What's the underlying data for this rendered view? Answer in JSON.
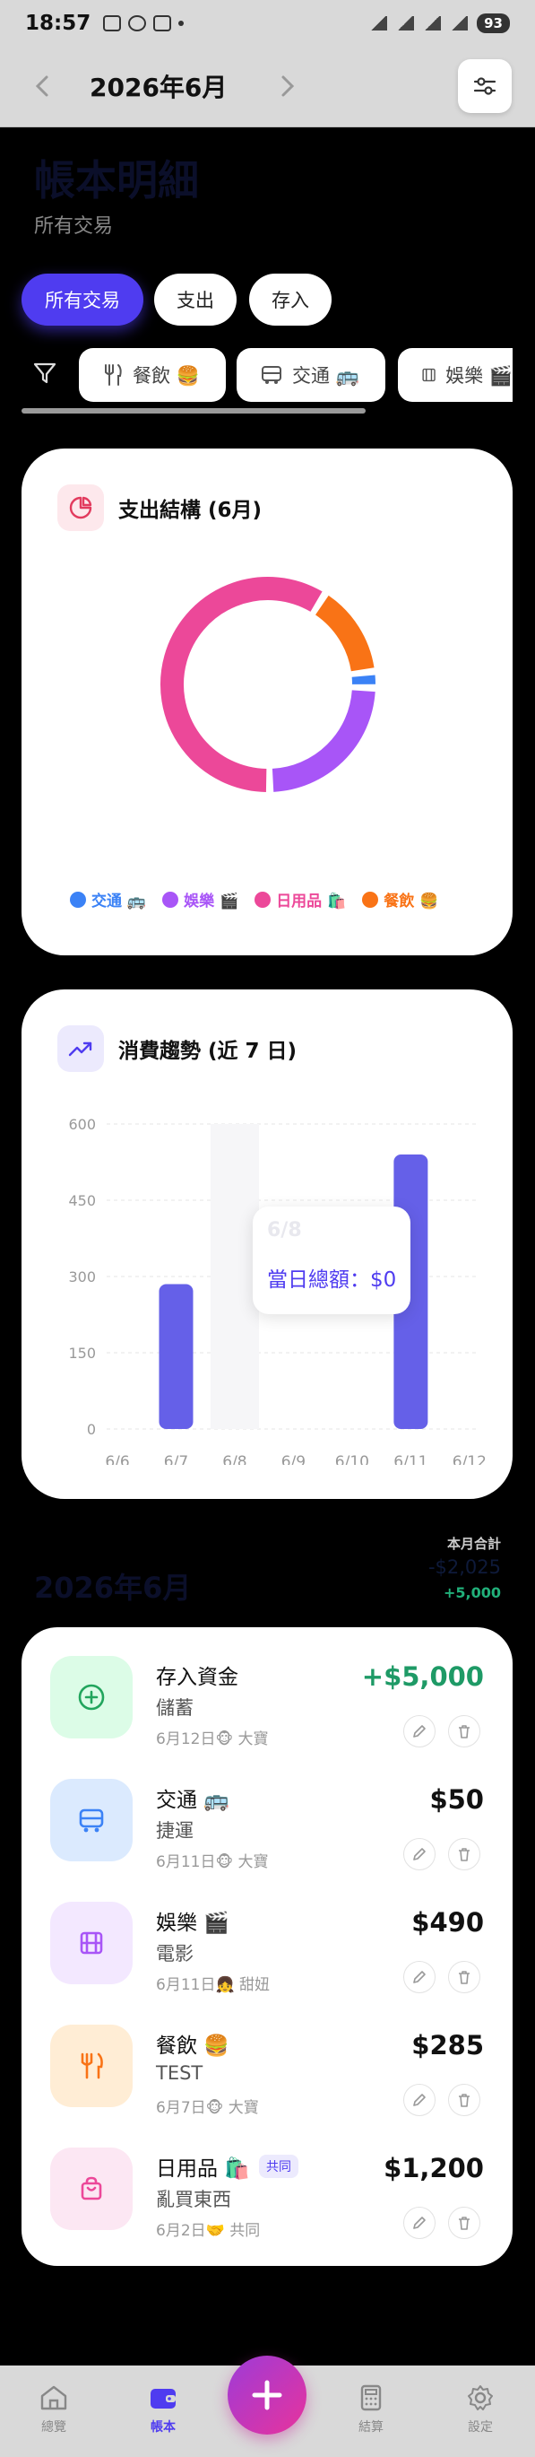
{
  "status_bar": {
    "time": "18:57",
    "battery": "93"
  },
  "header": {
    "month_title": "2026年6月"
  },
  "page": {
    "title": "帳本明細",
    "subtitle": "所有交易"
  },
  "segments": [
    {
      "label": "所有交易",
      "active": true
    },
    {
      "label": "支出",
      "active": false
    },
    {
      "label": "存入",
      "active": false
    }
  ],
  "categories": [
    {
      "label": "餐飲 🍔",
      "icon": "utensils-icon"
    },
    {
      "label": "交通 🚌",
      "icon": "bus-icon"
    },
    {
      "label": "娛樂 🎬",
      "icon": "film-icon"
    }
  ],
  "structure_card": {
    "title": "支出結構 (6月)",
    "legend": [
      {
        "label": "交通 🚌",
        "color": "#3b82f6"
      },
      {
        "label": "娛樂 🎬",
        "color": "#a855f7"
      },
      {
        "label": "日用品 🛍️",
        "color": "#ec4899"
      },
      {
        "label": "餐飲 🍔",
        "color": "#f97316"
      }
    ]
  },
  "trend_card": {
    "title": "消費趨勢 (近 7 日)",
    "tooltip": {
      "date": "6/8",
      "text": "當日總額：$0"
    }
  },
  "chart_data": [
    {
      "type": "pie",
      "title": "支出結構 (6月)",
      "categories": [
        "交通 🚌",
        "娛樂 🎬",
        "日用品 🛍️",
        "餐飲 🍔"
      ],
      "values": [
        50,
        490,
        1200,
        285
      ],
      "colors": [
        "#3b82f6",
        "#a855f7",
        "#ec4899",
        "#f97316"
      ]
    },
    {
      "type": "bar",
      "title": "消費趨勢 (近 7 日)",
      "categories": [
        "6/6",
        "6/7",
        "6/8",
        "6/9",
        "6/10",
        "6/11",
        "6/12"
      ],
      "values": [
        0,
        285,
        0,
        0,
        0,
        540,
        0
      ],
      "yticks": [
        0,
        150,
        300,
        450,
        600
      ],
      "ylim": [
        0,
        600
      ],
      "grid": true,
      "bar_color": "#6560e8",
      "highlight_category": "6/8"
    }
  ],
  "month_summary": {
    "title": "2026年6月",
    "label": "本月合計",
    "net": "-$2,025",
    "income": "+5,000"
  },
  "transactions": [
    {
      "icon": "plus-circle-icon",
      "icon_bg": "#dcfce7",
      "icon_color": "#22a55d",
      "title": "存入資金",
      "subtitle": "儲蓄",
      "meta": "6月12日🐵 大寶",
      "amount": "+$5,000",
      "income": true,
      "badge": ""
    },
    {
      "icon": "bus-icon",
      "icon_bg": "#dbeafe",
      "icon_color": "#3b82f6",
      "title": "交通 🚌",
      "subtitle": "捷運",
      "meta": "6月11日🐵 大寶",
      "amount": "$50",
      "income": false,
      "badge": ""
    },
    {
      "icon": "film-icon",
      "icon_bg": "#f3e8ff",
      "icon_color": "#a855f7",
      "title": "娛樂 🎬",
      "subtitle": "電影",
      "meta": "6月11日👧 甜妞",
      "amount": "$490",
      "income": false,
      "badge": ""
    },
    {
      "icon": "utensils-icon",
      "icon_bg": "#ffedd5",
      "icon_color": "#f97316",
      "title": "餐飲 🍔",
      "subtitle": "TEST",
      "meta": "6月7日🐵 大寶",
      "amount": "$285",
      "income": false,
      "badge": ""
    },
    {
      "icon": "shopping-bag-icon",
      "icon_bg": "#fce7f3",
      "icon_color": "#ec4899",
      "title": "日用品 🛍️",
      "subtitle": "亂買東西",
      "meta": "6月2日🤝 共同",
      "amount": "$1,200",
      "income": false,
      "badge": "共同"
    }
  ],
  "bottom_nav": [
    {
      "label": "總覽",
      "icon": "home-icon",
      "active": false
    },
    {
      "label": "帳本",
      "icon": "wallet-icon",
      "active": true
    },
    {
      "label": "結算",
      "icon": "calculator-icon",
      "active": false
    },
    {
      "label": "設定",
      "icon": "gear-icon",
      "active": false
    }
  ]
}
